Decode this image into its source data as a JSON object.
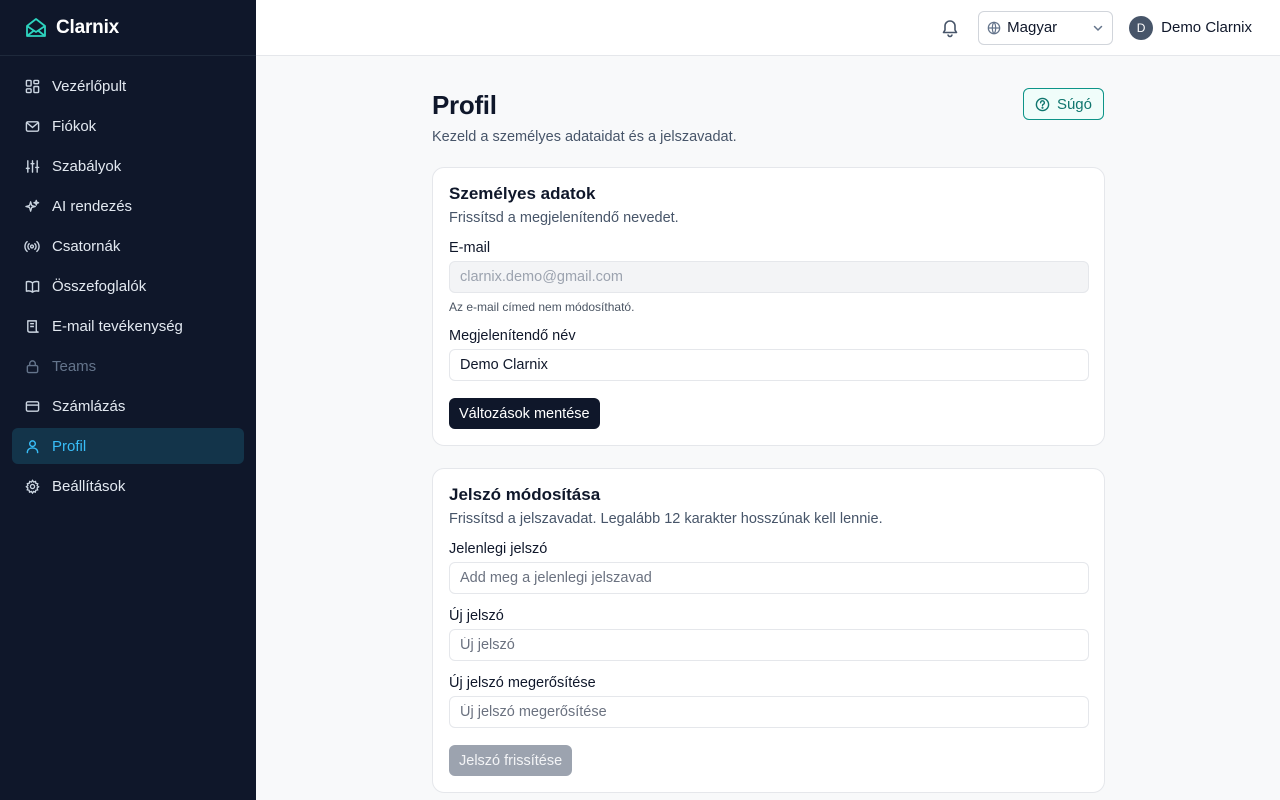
{
  "app": {
    "name": "Clarnix"
  },
  "sidebar": {
    "items": [
      {
        "label": "Vezérlőpult",
        "icon": "dashboard-icon"
      },
      {
        "label": "Fiókok",
        "icon": "mail-icon"
      },
      {
        "label": "Szabályok",
        "icon": "sliders-icon"
      },
      {
        "label": "AI rendezés",
        "icon": "sparkles-icon"
      },
      {
        "label": "Csatornák",
        "icon": "radio-icon"
      },
      {
        "label": "Összefoglalók",
        "icon": "book-icon"
      },
      {
        "label": "E-mail tevékenység",
        "icon": "scroll-icon"
      },
      {
        "label": "Teams",
        "icon": "lock-icon",
        "disabled": true
      },
      {
        "label": "Számlázás",
        "icon": "credit-card-icon"
      },
      {
        "label": "Profil",
        "icon": "user-icon",
        "active": true
      },
      {
        "label": "Beállítások",
        "icon": "gear-icon"
      }
    ]
  },
  "header": {
    "language": "Magyar",
    "user": {
      "initial": "D",
      "name": "Demo Clarnix"
    }
  },
  "page": {
    "title": "Profil",
    "subtitle": "Kezeld a személyes adataidat és a jelszavadat.",
    "help_label": "Súgó"
  },
  "personal": {
    "title": "Személyes adatok",
    "subtitle": "Frissítsd a megjelenítendő nevedet.",
    "email_label": "E-mail",
    "email_value": "clarnix.demo@gmail.com",
    "email_hint": "Az e-mail címed nem módosítható.",
    "name_label": "Megjelenítendő név",
    "name_value": "Demo Clarnix",
    "save_label": "Változások mentése"
  },
  "password": {
    "title": "Jelszó módosítása",
    "subtitle": "Frissítsd a jelszavadat. Legalább 12 karakter hosszúnak kell lennie.",
    "current_label": "Jelenlegi jelszó",
    "current_placeholder": "Add meg a jelenlegi jelszavad",
    "new_label": "Új jelszó",
    "new_placeholder": "Új jelszó",
    "confirm_label": "Új jelszó megerősítése",
    "confirm_placeholder": "Új jelszó megerősítése",
    "submit_label": "Jelszó frissítése"
  },
  "colors": {
    "sidebar_bg": "#0f172a",
    "active_accent": "#38bdf8",
    "help_accent": "#0d9488",
    "primary_button": "#0f172a"
  }
}
